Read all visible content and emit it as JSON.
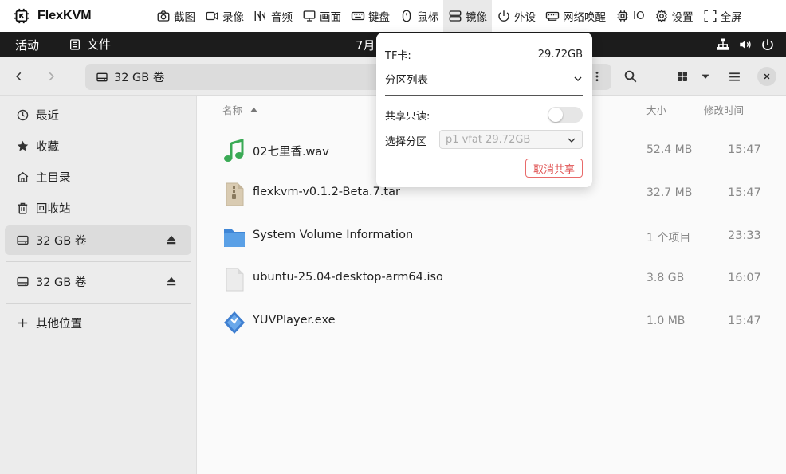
{
  "kvm": {
    "brand": "FlexKVM",
    "menu": [
      {
        "label": "截图",
        "icon": "camera-icon"
      },
      {
        "label": "录像",
        "icon": "video-icon"
      },
      {
        "label": "音频",
        "icon": "audio-icon"
      },
      {
        "label": "画面",
        "icon": "monitor-icon"
      },
      {
        "label": "键盘",
        "icon": "keyboard-icon"
      },
      {
        "label": "鼠标",
        "icon": "mouse-icon"
      },
      {
        "label": "镜像",
        "icon": "storage-icon",
        "active": true
      },
      {
        "label": "外设",
        "icon": "power-icon"
      },
      {
        "label": "网络唤醒",
        "icon": "network-icon"
      },
      {
        "label": "IO",
        "icon": "chip-icon"
      },
      {
        "label": "设置",
        "icon": "gear-icon"
      },
      {
        "label": "全屏",
        "icon": "fullscreen-icon"
      }
    ]
  },
  "topbar": {
    "activities": "活动",
    "app": "文件",
    "clock": "7月"
  },
  "header": {
    "location": "32 GB 卷"
  },
  "sidebar": {
    "items": [
      {
        "label": "最近",
        "icon": "clock-icon"
      },
      {
        "label": "收藏",
        "icon": "star-icon"
      },
      {
        "label": "主目录",
        "icon": "home-icon"
      },
      {
        "label": "回收站",
        "icon": "trash-icon"
      },
      {
        "label": "32 GB 卷",
        "icon": "drive-icon",
        "selected": true
      },
      {
        "label": "32 GB 卷",
        "icon": "drive-icon"
      },
      {
        "label": "其他位置",
        "icon": "plus-icon"
      }
    ]
  },
  "columns": {
    "name": "名称",
    "size": "大小",
    "modified": "修改时间"
  },
  "files": [
    {
      "name": "02七里香.wav",
      "size": "52.4 MB",
      "time": "15:47",
      "icon": "audio-file-icon"
    },
    {
      "name": "flexkvm-v0.1.2-Beta.7.tar",
      "size": "32.7 MB",
      "time": "15:47",
      "icon": "archive-file-icon"
    },
    {
      "name": "System Volume Information",
      "size": "1 个项目",
      "time": "23:33",
      "icon": "folder-icon"
    },
    {
      "name": "ubuntu-25.04-desktop-arm64.iso",
      "size": "3.8 GB",
      "time": "16:07",
      "icon": "disk-image-file-icon"
    },
    {
      "name": "YUVPlayer.exe",
      "size": "1.0 MB",
      "time": "15:47",
      "icon": "executable-file-icon"
    }
  ],
  "popover": {
    "tf_label": "TF卡:",
    "tf_value": "29.72GB",
    "partition_list": "分区列表",
    "readonly_label": "共享只读:",
    "readonly_on": false,
    "select_label": "选择分区",
    "select_value": "p1 vfat 29.72GB",
    "unshare": "取消共享"
  },
  "colors": {
    "accent_danger": "#e05555",
    "folder_blue": "#5aa0e6",
    "audio_green": "#3aaa55"
  }
}
